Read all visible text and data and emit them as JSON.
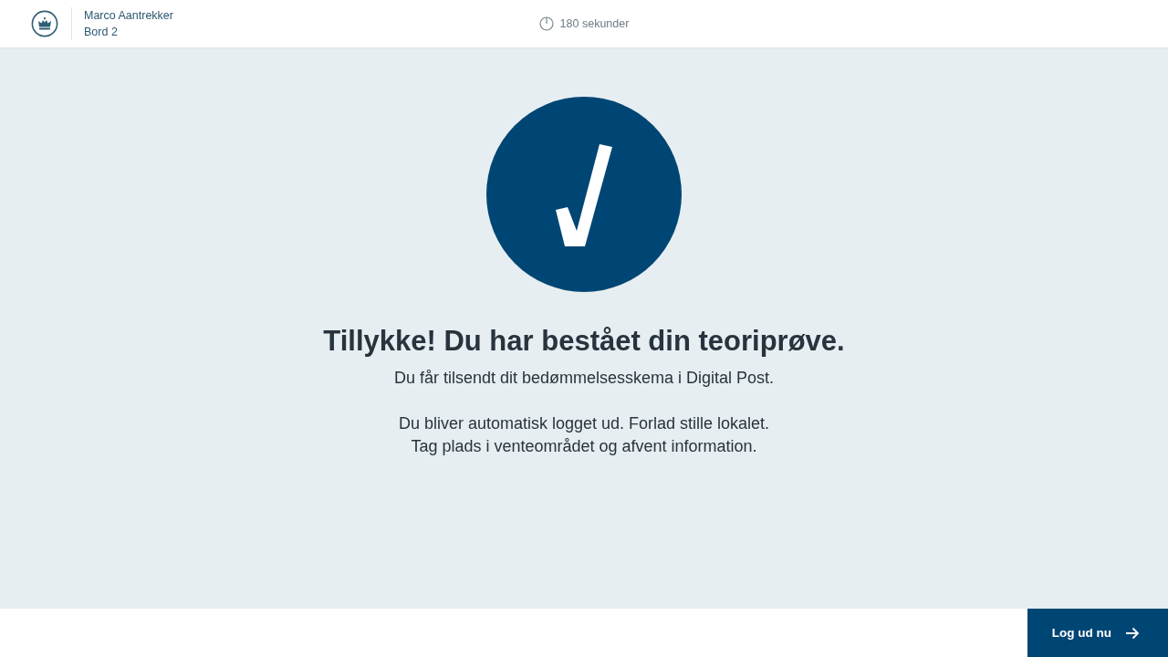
{
  "header": {
    "user_name": "Marco Aantrekker",
    "station": "Bord 2",
    "timer": "180 sekunder"
  },
  "result": {
    "passed": true,
    "heading": "Tillykke! Du har bestået din teoriprøve.",
    "paragraphs": [
      "Du får tilsendt dit bedømmelsesskema i Digital Post.",
      "Du bliver automatisk logget ud. Forlad stille lokalet.\nTag plads i venteområdet og afvent information."
    ]
  },
  "footer": {
    "button": "Log ud nu"
  }
}
